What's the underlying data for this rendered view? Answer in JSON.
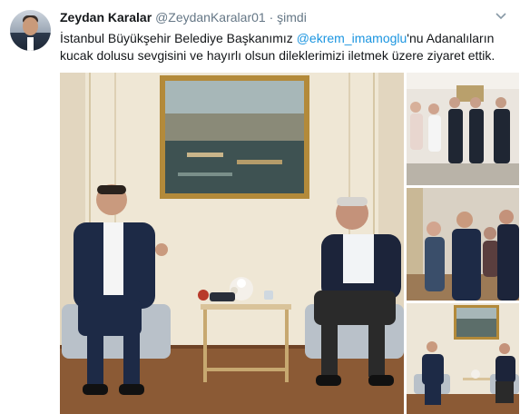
{
  "tweet": {
    "author_name": "Zeydan Karalar",
    "author_handle": "@ZeydanKaralar01",
    "separator": "·",
    "timestamp": "şimdi",
    "text_before": "İstanbul Büyükşehir Belediye Başkanımız ",
    "mention": "@ekrem_imamoglu",
    "text_after": "'nu Adanalıların kucak dolusu sevgisini ve hayırlı olsun dileklerimizi iletmek üzere ziyaret ettik."
  },
  "icons": {
    "more": "chevron-down-icon",
    "avatar": "profile-avatar"
  },
  "colors": {
    "name": "#14171a",
    "meta": "#657786",
    "link": "#1b95e0"
  }
}
